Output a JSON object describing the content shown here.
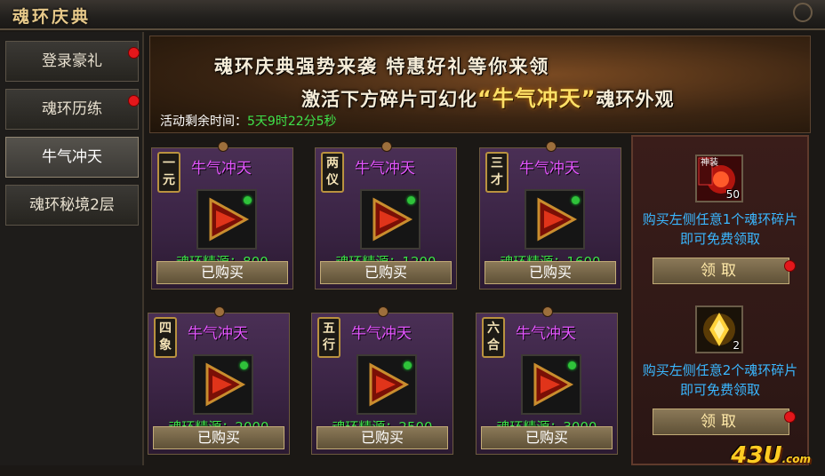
{
  "window": {
    "title": "魂环庆典"
  },
  "sidebar": {
    "items": [
      {
        "label": "登录豪礼",
        "active": false,
        "badge": true
      },
      {
        "label": "魂环历练",
        "active": false,
        "badge": true
      },
      {
        "label": "牛气冲天",
        "active": true,
        "badge": false
      },
      {
        "label": "魂环秘境2层",
        "active": false,
        "badge": false
      }
    ]
  },
  "banner": {
    "line1": "魂环庆典强势来袭   特惠好礼等你来领",
    "line2_pre": "激活下方碎片可幻化",
    "line2_highlight": "“牛气冲天”",
    "line2_post": "魂环外观"
  },
  "timer": {
    "label": "活动剩余时间：",
    "value": "5天9时22分5秒"
  },
  "cards": [
    {
      "tag": "一元",
      "name": "牛气冲天",
      "cost": "魂环精源：800",
      "button": "已购买"
    },
    {
      "tag": "两仪",
      "name": "牛气冲天",
      "cost": "魂环精源：1200",
      "button": "已购买"
    },
    {
      "tag": "三才",
      "name": "牛气冲天",
      "cost": "魂环精源：1600",
      "button": "已购买"
    },
    {
      "tag": "四象",
      "name": "牛气冲天",
      "cost": "魂环精源：2000",
      "button": "已购买"
    },
    {
      "tag": "五行",
      "name": "牛气冲天",
      "cost": "魂环精源：2500",
      "button": "已购买"
    },
    {
      "tag": "六合",
      "name": "牛气冲天",
      "cost": "魂环精源：3000",
      "button": "已购买"
    }
  ],
  "rewards": [
    {
      "icon_label": "神装",
      "count": "50",
      "desc": "购买左侧任意1个魂环碎片即可免费领取",
      "button": "领取"
    },
    {
      "icon_label": "",
      "count": "2",
      "desc": "购买左侧任意2个魂环碎片即可免费领取",
      "button": "领取"
    }
  ],
  "watermark": {
    "main": "43U",
    "suffix": ".com"
  },
  "colors": {
    "accent_green": "#3fe24a",
    "name_purple": "#e455ff",
    "reward_blue": "#3ab7ff",
    "badge_red": "#e3171b"
  }
}
